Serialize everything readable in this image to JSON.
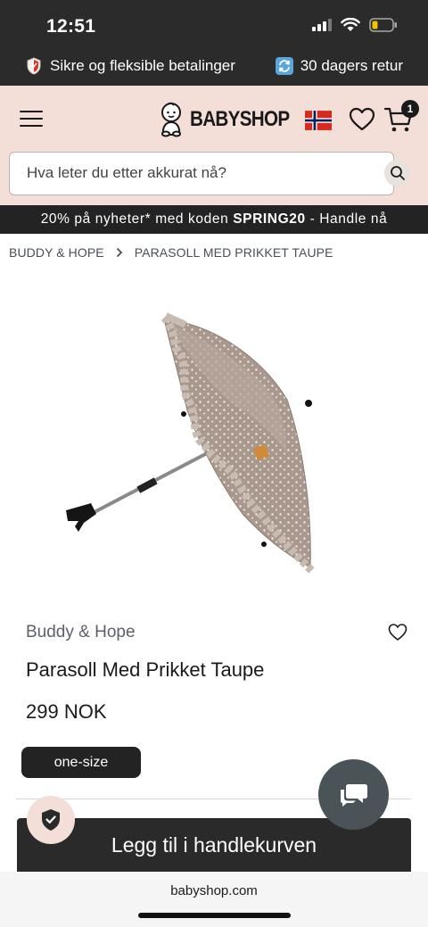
{
  "status": {
    "time": "12:51"
  },
  "promo": {
    "left_text": "Sikre og fleksible betalinger",
    "right_text": "30 dagers retur"
  },
  "header": {
    "logo_text": "BABYSHOP",
    "cart_count": "1"
  },
  "search": {
    "placeholder": "Hva leter du etter akkurat nå?"
  },
  "campaign": {
    "prefix": "20% på nyheter* med koden ",
    "code": "SPRING20",
    "suffix": " - Handle nå"
  },
  "breadcrumb": {
    "items": [
      "BUDDY & HOPE",
      "PARASOLL MED PRIKKET TAUPE"
    ]
  },
  "product": {
    "brand": "Buddy & Hope",
    "title": "Parasoll Med Prikket Taupe",
    "price": "299 NOK",
    "size_option": "one-size",
    "add_to_cart_label": "Legg til i handlekurven"
  },
  "browser": {
    "url": "babyshop.com"
  },
  "colors": {
    "dark": "#2b2b2b",
    "header_bg": "#f3dfd8",
    "chat_button": "#4a5358"
  },
  "icons": [
    "signal-icon",
    "wifi-icon",
    "battery-icon",
    "shield-icon",
    "return-icon",
    "menu-icon",
    "baby-logo-icon",
    "norway-flag-icon",
    "heart-icon",
    "cart-icon",
    "search-icon",
    "chevron-right-icon",
    "chat-icon",
    "verified-shield-icon"
  ]
}
